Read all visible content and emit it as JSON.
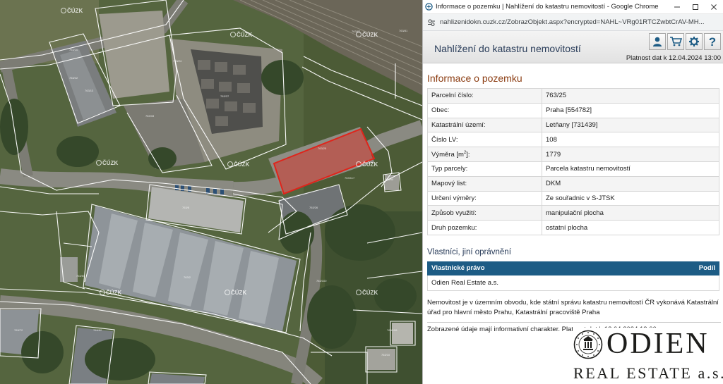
{
  "browser": {
    "window_title": "Informace o pozemku | Nahlížení do katastru nemovitostí - Google Chrome",
    "url": "nahlizenidokn.cuzk.cz/ZobrazObjekt.aspx?encrypted=NAHL~VRg01RTCZwbtCrAV-MH..."
  },
  "map": {
    "watermark": "ČÚZK",
    "highlight_color": "#e0241a"
  },
  "app": {
    "title": "Nahlížení do katastru nemovitostí",
    "validity": "Platnost dat k 12.04.2024 13:00",
    "toolbar": [
      "person-icon",
      "cart-icon",
      "gear-icon",
      "help-icon"
    ],
    "help_glyph": "?"
  },
  "parcel": {
    "section_title": "Informace o pozemku",
    "rows": [
      {
        "label": "Parcelní číslo:",
        "value": "763/25"
      },
      {
        "label": "Obec:",
        "value": "Praha [554782]"
      },
      {
        "label": "Katastrální území:",
        "value": "Letňany [731439]"
      },
      {
        "label": "Číslo LV:",
        "value": "108"
      },
      {
        "label_main": "Výměra [m",
        "label_sup": "2",
        "label_end": "]:",
        "value": "1779"
      },
      {
        "label": "Typ parcely:",
        "value": "Parcela katastru nemovitostí"
      },
      {
        "label": "Mapový list:",
        "value": "DKM"
      },
      {
        "label": "Určení výměry:",
        "value": "Ze souřadnic v S-JTSK"
      },
      {
        "label": "Způsob využití:",
        "value": "manipulační plocha"
      },
      {
        "label": "Druh pozemku:",
        "value": "ostatní plocha"
      }
    ]
  },
  "owners": {
    "section_title": "Vlastníci, jiní oprávnění",
    "header_right": "Vlastnické právo",
    "header_share": "Podíl",
    "owner": "Odien Real Estate a.s."
  },
  "note": "Nemovitost je v územním obvodu, kde státní správu katastru nemovitostí ČR vykonává Katastrální úřad pro hlavní město Prahu, Katastrální pracoviště Praha",
  "disclaimer": "Zobrazené údaje mají informativní charakter. Platnost dat k 12.04.2024 13:00.",
  "logo": {
    "name": "ODIEN",
    "subtitle": "REAL ESTATE a.s."
  }
}
